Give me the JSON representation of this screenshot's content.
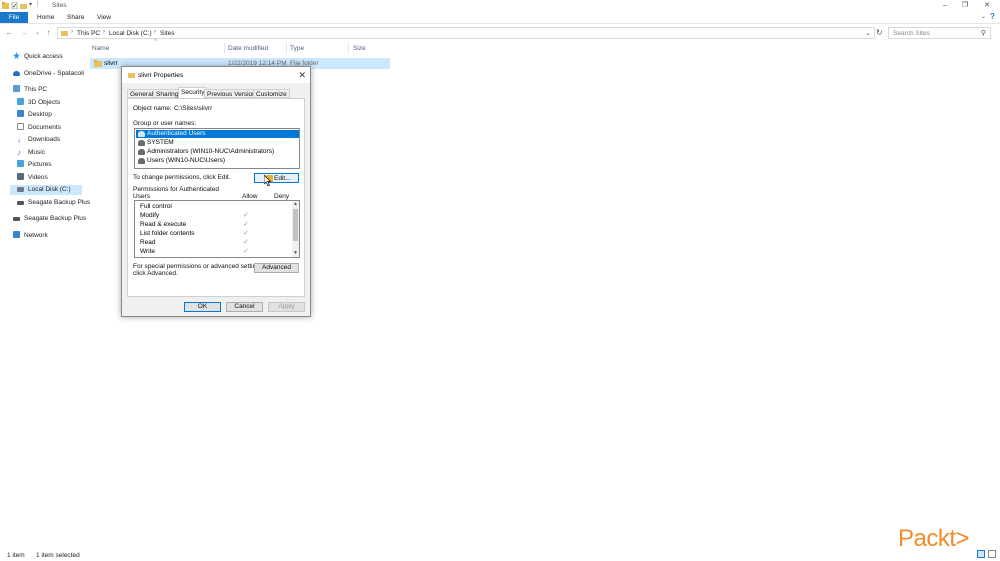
{
  "window": {
    "title": "Sites",
    "quick_access_icons": [
      "save-icon",
      "properties-icon",
      "new-folder-icon",
      "customize-icon"
    ],
    "controls": [
      "minimize-icon",
      "restore-icon",
      "close-icon"
    ]
  },
  "ribbon": {
    "tabs": [
      "File",
      "Home",
      "Share",
      "View"
    ]
  },
  "address": {
    "crumbs": [
      "This PC",
      "Local Disk (C:)",
      "Sites"
    ],
    "search_placeholder": "Search Sites"
  },
  "nav": {
    "items": [
      {
        "label": "Quick access",
        "icon": "star-icon",
        "color": "#1e90ff"
      },
      {
        "label": "OneDrive - Spatacoli",
        "icon": "cloud-icon",
        "color": "#1e6fc8"
      },
      {
        "label": "This PC",
        "icon": "computer-icon",
        "color": "#5a9bd5"
      },
      {
        "label": "3D Objects",
        "icon": "cube-icon",
        "color": "#4aa3df"
      },
      {
        "label": "Desktop",
        "icon": "desktop-icon",
        "color": "#3a86c8"
      },
      {
        "label": "Documents",
        "icon": "documents-icon",
        "color": "#7f8c8d"
      },
      {
        "label": "Downloads",
        "icon": "download-icon",
        "color": "#2e7dd1"
      },
      {
        "label": "Music",
        "icon": "music-icon",
        "color": "#2e7dd1"
      },
      {
        "label": "Pictures",
        "icon": "pictures-icon",
        "color": "#4aa3df"
      },
      {
        "label": "Videos",
        "icon": "videos-icon",
        "color": "#5b6b7a"
      },
      {
        "label": "Local Disk (C:)",
        "icon": "drive-icon",
        "color": "#6d7b88"
      },
      {
        "label": "Seagate Backup Plus",
        "icon": "drive-icon",
        "color": "#555555"
      },
      {
        "label": "Seagate Backup Plus",
        "icon": "drive-icon",
        "color": "#555555"
      },
      {
        "label": "Network",
        "icon": "network-icon",
        "color": "#3a86c8"
      }
    ]
  },
  "filelist": {
    "columns": [
      "Name",
      "Date modified",
      "Type",
      "Size"
    ],
    "rows": [
      {
        "name": "slivrr",
        "date": "1/22/2019 12:14 PM",
        "type": "File folder",
        "size": ""
      }
    ]
  },
  "status": {
    "count": "1 item",
    "selected": "1 item selected"
  },
  "dialog": {
    "title": "slivrr Properties",
    "tabs": [
      "General",
      "Sharing",
      "Security",
      "Previous Versions",
      "Customize"
    ],
    "active_tab": "Security",
    "object_name_label": "Object name:",
    "object_name_value": "C:\\Sites\\slivrr",
    "group_label": "Group or user names:",
    "users": [
      "Authenticated Users",
      "SYSTEM",
      "Administrators (WIN10-NUC\\Administrators)",
      "Users (WIN10-NUC\\Users)"
    ],
    "change_text": "To change permissions, click Edit.",
    "edit_button": "Edit...",
    "perm_header_line1": "Permissions for Authenticated",
    "perm_header_line2": "Users",
    "allow_label": "Allow",
    "deny_label": "Deny",
    "permissions": [
      {
        "name": "Full control",
        "allow": false
      },
      {
        "name": "Modify",
        "allow": true
      },
      {
        "name": "Read & execute",
        "allow": true
      },
      {
        "name": "List folder contents",
        "allow": true
      },
      {
        "name": "Read",
        "allow": true
      },
      {
        "name": "Write",
        "allow": true
      }
    ],
    "special_text_line1": "For special permissions or advanced settings,",
    "special_text_line2": "click Advanced.",
    "advanced_button": "Advanced",
    "ok": "OK",
    "cancel": "Cancel",
    "apply": "Apply"
  },
  "logo": {
    "text": "Packt>",
    "color": "#f28c28"
  }
}
